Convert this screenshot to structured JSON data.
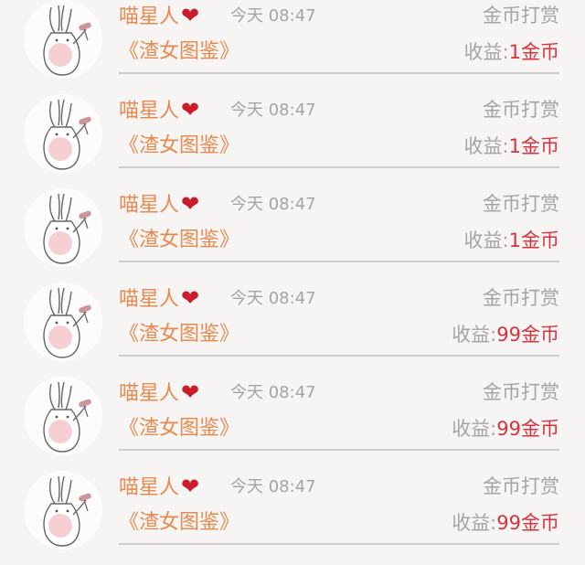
{
  "rows": [
    {
      "name": "喵星人",
      "time": "今天 08:47",
      "action": "金币打赏",
      "book": "《渣女图鉴》",
      "earn_label": "收益:",
      "earn_value": "1金币"
    },
    {
      "name": "喵星人",
      "time": "今天 08:47",
      "action": "金币打赏",
      "book": "《渣女图鉴》",
      "earn_label": "收益:",
      "earn_value": "1金币"
    },
    {
      "name": "喵星人",
      "time": "今天 08:47",
      "action": "金币打赏",
      "book": "《渣女图鉴》",
      "earn_label": "收益:",
      "earn_value": "1金币"
    },
    {
      "name": "喵星人",
      "time": "今天 08:47",
      "action": "金币打赏",
      "book": "《渣女图鉴》",
      "earn_label": "收益:",
      "earn_value": "99金币"
    },
    {
      "name": "喵星人",
      "time": "今天 08:47",
      "action": "金币打赏",
      "book": "《渣女图鉴》",
      "earn_label": "收益:",
      "earn_value": "99金币"
    },
    {
      "name": "喵星人",
      "time": "今天 08:47",
      "action": "金币打赏",
      "book": "《渣女图鉴》",
      "earn_label": "收益:",
      "earn_value": "99金币"
    }
  ],
  "icons": {
    "heart": "heart-icon",
    "avatar": "bunny-avatar"
  },
  "colors": {
    "name": "#e88a4e",
    "amount": "#d8323c",
    "muted": "#a7a3a3",
    "heart": "#cc1b2a"
  }
}
